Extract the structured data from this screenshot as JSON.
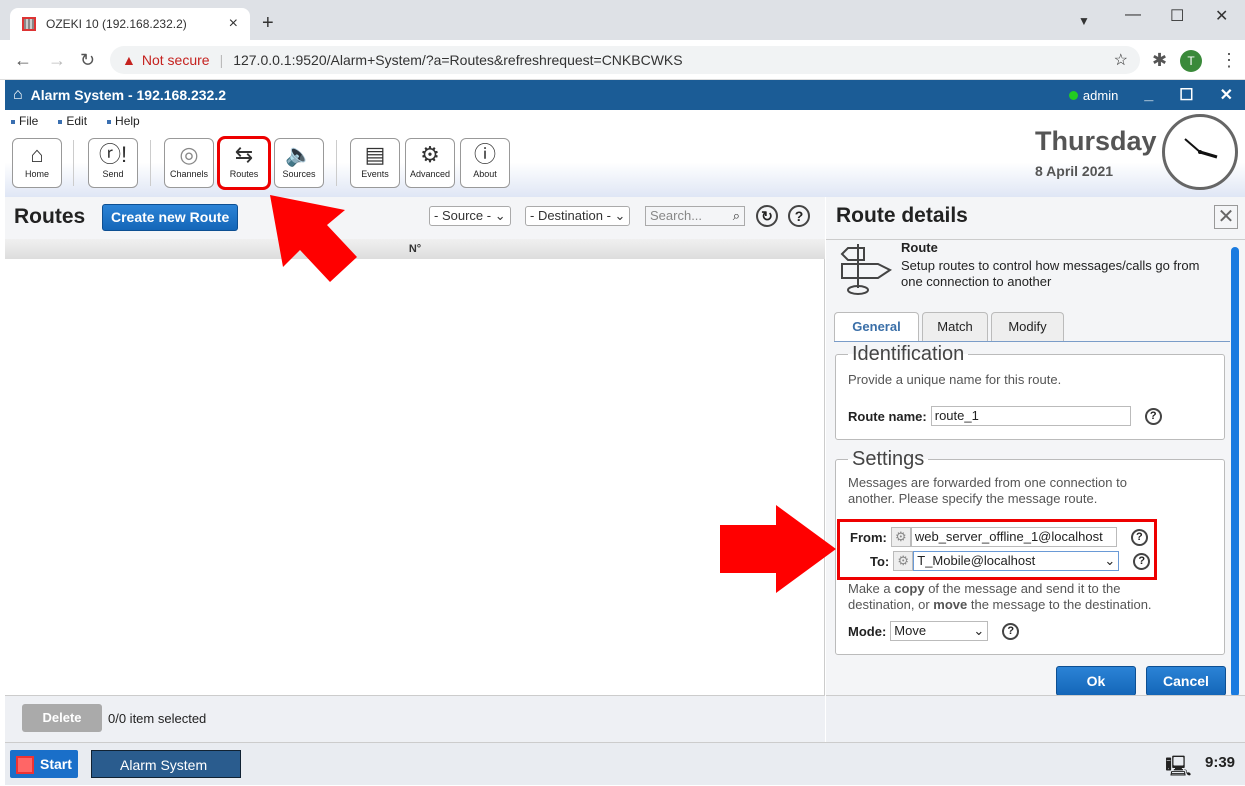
{
  "browser": {
    "tab_title": "OZEKI 10 (192.168.232.2)",
    "not_secure": "Not secure",
    "url": "127.0.0.1:9520/Alarm+System/?a=Routes&refreshrequest=CNKBCWKS",
    "profile_initial": "T"
  },
  "app": {
    "title": "Alarm System - 192.168.232.2",
    "user": "admin",
    "user_status_color": "#22cc22"
  },
  "menu": [
    "File",
    "Edit",
    "Help"
  ],
  "toolbar": [
    {
      "label": "Home",
      "icon": "home-icon"
    },
    {
      "label": "Send",
      "icon": "send-icon"
    },
    {
      "label": "Channels",
      "icon": "channels-icon"
    },
    {
      "label": "Routes",
      "icon": "routes-icon",
      "selected": true
    },
    {
      "label": "Sources",
      "icon": "speaker-icon"
    },
    {
      "label": "Events",
      "icon": "events-icon"
    },
    {
      "label": "Advanced",
      "icon": "gear-icon"
    },
    {
      "label": "About",
      "icon": "info-icon"
    }
  ],
  "clock": {
    "day": "Thursday",
    "date": "8 April 2021"
  },
  "routes": {
    "title": "Routes",
    "create_label": "Create new Route",
    "source_filter": "- Source -",
    "destination_filter": "- Destination -",
    "search_placeholder": "Search...",
    "column_header": "N°",
    "delete_label": "Delete",
    "selection_info": "0/0 item selected"
  },
  "details": {
    "title": "Route details",
    "heading": "Route",
    "description": "Setup routes to control how messages/calls go from one connection to another",
    "tabs": [
      "General",
      "Match",
      "Modify"
    ],
    "identification": {
      "legend": "Identification",
      "hint": "Provide a unique name for this route.",
      "name_label": "Route name:",
      "name_value": "route_1"
    },
    "settings": {
      "legend": "Settings",
      "hint": "Messages are forwarded from one connection to another. Please specify the message route.",
      "from_label": "From:",
      "from_value": "web_server_offline_1@localhost",
      "to_label": "To:",
      "to_value": "T_Mobile@localhost",
      "mode_hint_1": "Make a ",
      "mode_hint_copy": "copy",
      "mode_hint_2": " of the message and send it to the destination, or ",
      "mode_hint_move": "move",
      "mode_hint_3": " the message to the destination.",
      "mode_label": "Mode:",
      "mode_value": "Move"
    },
    "ok_label": "Ok",
    "cancel_label": "Cancel"
  },
  "taskbar": {
    "start_label": "Start",
    "app_label": "Alarm System",
    "time": "9:39"
  },
  "colors": {
    "title_bar": "#1b5c96",
    "accent_button": "#1a6fc9",
    "highlight": "#ee0000"
  }
}
